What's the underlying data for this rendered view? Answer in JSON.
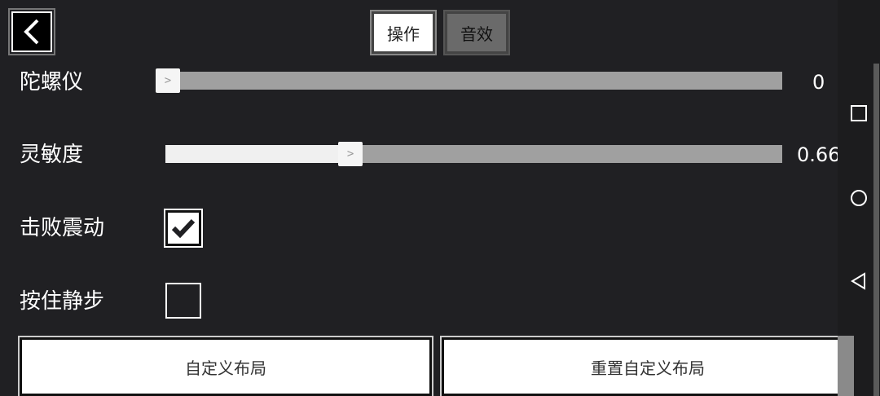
{
  "header": {
    "back_icon": "chevron-left-icon",
    "tabs": [
      {
        "label": "操作",
        "active": true
      },
      {
        "label": "音效",
        "active": false
      }
    ]
  },
  "settings": {
    "gyroscope": {
      "label": "陀螺仪",
      "value": "0",
      "fraction": 0.0
    },
    "sensitivity": {
      "label": "灵敏度",
      "value": "0.66",
      "fraction": 0.296
    },
    "defeat_vibration": {
      "label": "击败震动",
      "checked": true
    },
    "hold_silent_step": {
      "label": "按住静步",
      "checked": false
    }
  },
  "buttons": {
    "custom_layout": "自定义布局",
    "reset_custom_layout": "重置自定义布局"
  },
  "navbar": {
    "icons": [
      "square-icon",
      "circle-icon",
      "triangle-back-icon"
    ]
  },
  "colors": {
    "background": "#202023",
    "track": "#a0a0a0",
    "track_fill": "#f0f0f0"
  }
}
